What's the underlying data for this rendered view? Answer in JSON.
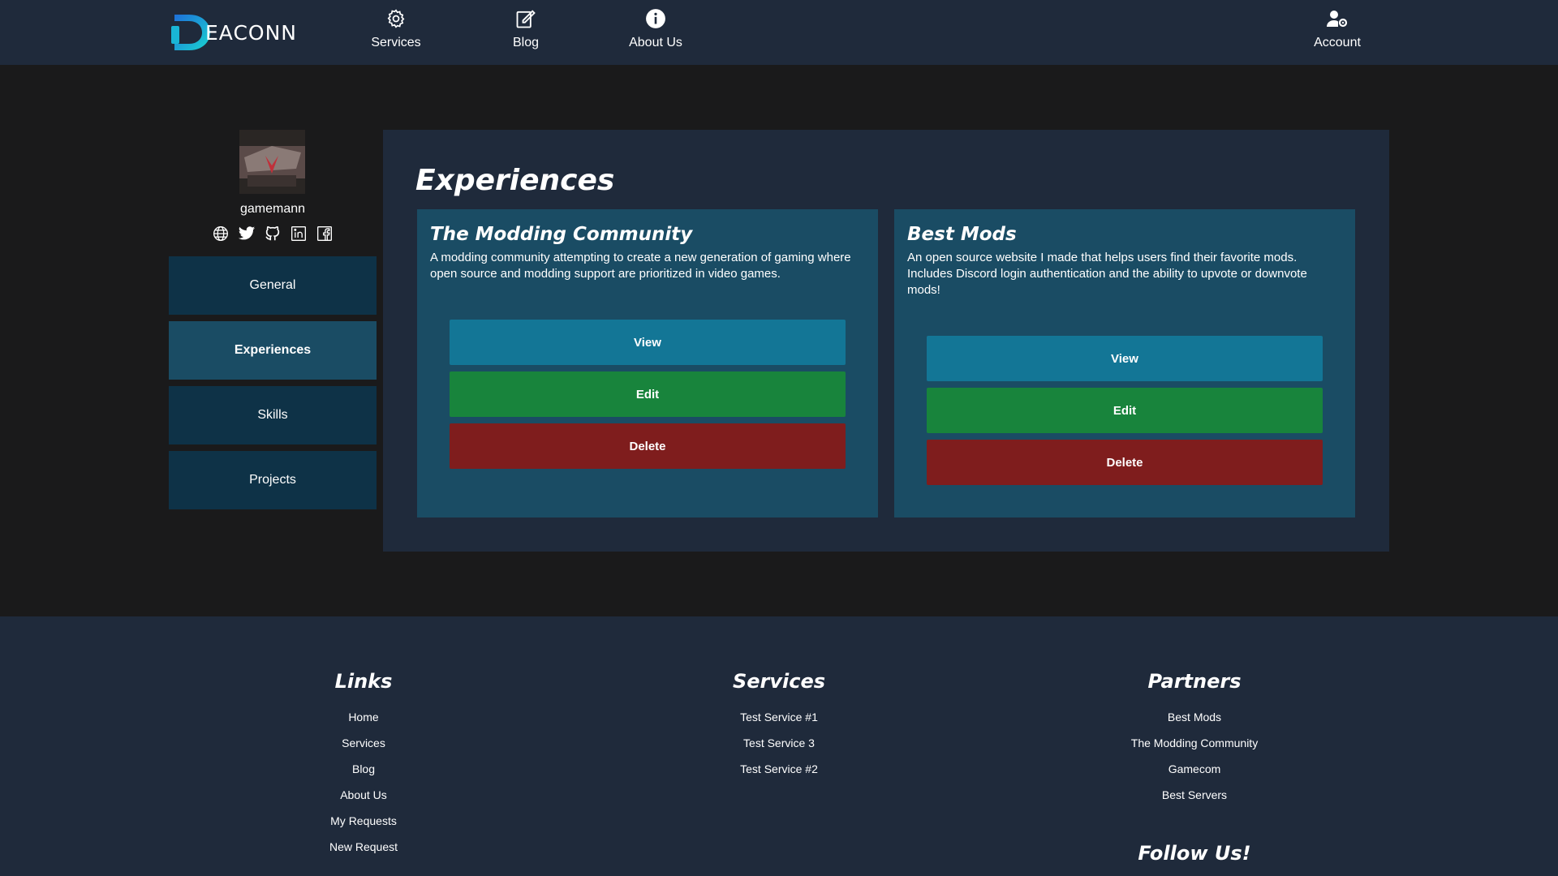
{
  "brand": {
    "logo_text": "EACONN",
    "accent": "#19b5d6"
  },
  "nav": {
    "services": "Services",
    "blog": "Blog",
    "about": "About Us",
    "account": "Account"
  },
  "profile": {
    "username": "gamemann",
    "socials": [
      "globe-icon",
      "twitter-icon",
      "github-icon",
      "linkedin-icon",
      "facebook-icon"
    ]
  },
  "sidebar": {
    "items": [
      {
        "label": "General",
        "active": false
      },
      {
        "label": "Experiences",
        "active": true
      },
      {
        "label": "Skills",
        "active": false
      },
      {
        "label": "Projects",
        "active": false
      }
    ]
  },
  "main": {
    "title": "Experiences",
    "cards": [
      {
        "title": "The Modding Community",
        "description": "A modding community attempting to create a new generation of gaming where open source and modding support are prioritized in video games.",
        "view": "View",
        "edit": "Edit",
        "delete": "Delete"
      },
      {
        "title": "Best Mods",
        "description": "An open source website I made that helps users find their favorite mods. Includes Discord login authentication and the ability to upvote or downvote mods!",
        "view": "View",
        "edit": "Edit",
        "delete": "Delete"
      }
    ]
  },
  "footer": {
    "links": {
      "title": "Links",
      "items": [
        "Home",
        "Services",
        "Blog",
        "About Us",
        "My Requests",
        "New Request"
      ]
    },
    "services": {
      "title": "Services",
      "items": [
        "Test Service #1",
        "Test Service 3",
        "Test Service #2"
      ]
    },
    "partners": {
      "title": "Partners",
      "items": [
        "Best Mods",
        "The Modding Community",
        "Gamecom",
        "Best Servers"
      ]
    },
    "follow": "Follow Us!"
  },
  "colors": {
    "header_bg": "#1f2a3b",
    "page_bg": "#1a1a1b",
    "card_bg": "#1a4c64",
    "view_button": "#137696",
    "edit_button": "#18843c",
    "delete_button": "#7f1d1d"
  }
}
